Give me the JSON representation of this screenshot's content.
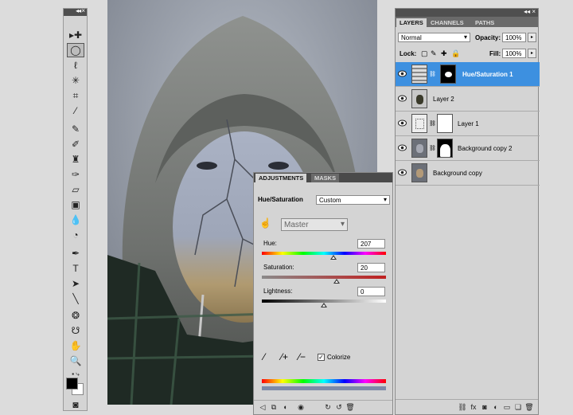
{
  "tools_panel": {
    "collapse_glyph": "◂◂ ×",
    "foreground_color": "#000000",
    "background_color": "#ffffff"
  },
  "adjustments": {
    "tabs": [
      "ADJUSTMENTS",
      "MASKS"
    ],
    "title": "Hue/Saturation",
    "preset": "Custom",
    "channel": "Master",
    "hue": {
      "label": "Hue:",
      "value": "207",
      "fraction": 0.575
    },
    "saturation": {
      "label": "Saturation:",
      "value": "20",
      "fraction": 0.6
    },
    "lightness": {
      "label": "Lightness:",
      "value": "0",
      "fraction": 0.5
    },
    "colorize_label": "Colorize",
    "colorize_checked": true
  },
  "layers": {
    "tabs": [
      "LAYERS",
      "CHANNELS",
      "PATHS"
    ],
    "blend_mode": "Normal",
    "opacity_label": "Opacity:",
    "opacity_value": "100%",
    "lock_label": "Lock:",
    "fill_label": "Fill:",
    "fill_value": "100%",
    "items": [
      {
        "name": "Hue/Saturation 1",
        "selected": true
      },
      {
        "name": "Layer 2",
        "selected": false
      },
      {
        "name": "Layer 1",
        "selected": false
      },
      {
        "name": "Background copy 2",
        "selected": false
      },
      {
        "name": "Background copy",
        "selected": false
      }
    ],
    "collapse_glyph": "◂◂ ×"
  }
}
